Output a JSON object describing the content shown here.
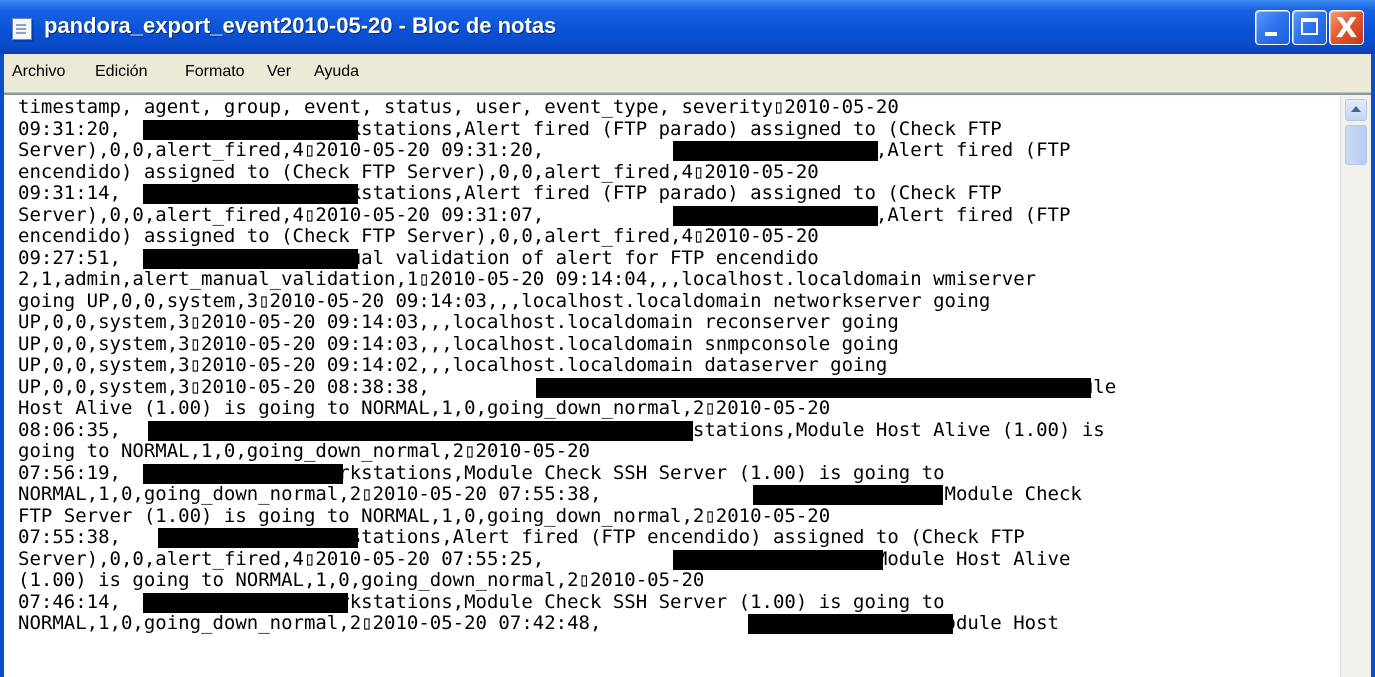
{
  "window": {
    "title": "pandora_export_event2010-05-20 - Bloc de notas",
    "icon": "notepad-icon",
    "controls": {
      "minimize": "minimize-icon",
      "maximize": "maximize-icon",
      "close_label": "X"
    }
  },
  "menu": {
    "items": [
      {
        "label": "Archivo"
      },
      {
        "label": "Edición"
      },
      {
        "label": "Formato"
      },
      {
        "label": "Ver"
      },
      {
        "label": "Ayuda"
      }
    ]
  },
  "editor": {
    "lines": [
      "timestamp, agent, group, event, status, user, event_type, severity▯2010-05-20",
      "09:31:20,                ,Workstations,Alert fired (FTP parado) assigned to (Check FTP",
      "Server),0,0,alert_fired,4▯2010-05-20 09:31:20,                ,Workstations,Alert fired (FTP",
      "encendido) assigned to (Check FTP Server),0,0,alert_fired,4▯2010-05-20",
      "09:31:14,                ,Workstations,Alert fired (FTP parado) assigned to (Check FTP",
      "Server),0,0,alert_fired,4▯2010-05-20 09:31:07,                ,Workstations,Alert fired (FTP",
      "encendido) assigned to (Check FTP Server),0,0,alert_fired,4▯2010-05-20",
      "09:27:51,                ,Manual validation of alert for FTP encendido",
      "2,1,admin,alert_manual_validation,1▯2010-05-20 09:14:04,,,localhost.localdomain wmiserver",
      "going UP,0,0,system,3▯2010-05-20 09:14:03,,,localhost.localdomain networkserver going",
      "UP,0,0,system,3▯2010-05-20 09:14:03,,,localhost.localdomain reconserver going",
      "UP,0,0,system,3▯2010-05-20 09:14:03,,,localhost.localdomain snmpconsole going",
      "UP,0,0,system,3▯2010-05-20 09:14:02,,,localhost.localdomain dataserver going",
      "UP,0,0,system,3▯2010-05-20 08:38:38,                                              Unknown,Module",
      "Host Alive (1.00) is going to NORMAL,1,0,going_down_normal,2▯2010-05-20",
      "08:06:35,                                              Workstations,Module Host Alive (1.00) is",
      "going to NORMAL,1,0,going_down_normal,2▯2010-05-20",
      "07:56:19,                ,Workstations,Module Check SSH Server (1.00) is going to",
      "NORMAL,1,0,going_down_normal,2▯2010-05-20 07:55:38,                ,Workstations,Module Check",
      "FTP Server (1.00) is going to NORMAL,1,0,going_down_normal,2▯2010-05-20",
      "07:55:38,                Workstations,Alert fired (FTP encendido) assigned to (Check FTP",
      "Server),0,0,alert_fired,4▯2010-05-20 07:55:25,                Workstations,Module Host Alive",
      "(1.00) is going to NORMAL,1,0,going_down_normal,2▯2010-05-20",
      "07:46:14,                ,Workstations,Module Check SSH Server (1.00) is going to",
      "NORMAL,1,0,going_down_normal,2▯2010-05-20 07:42:48,                Workstations,Module Host"
    ]
  },
  "scrollbar": {
    "up_icon": "scroll-up-arrow-icon"
  }
}
